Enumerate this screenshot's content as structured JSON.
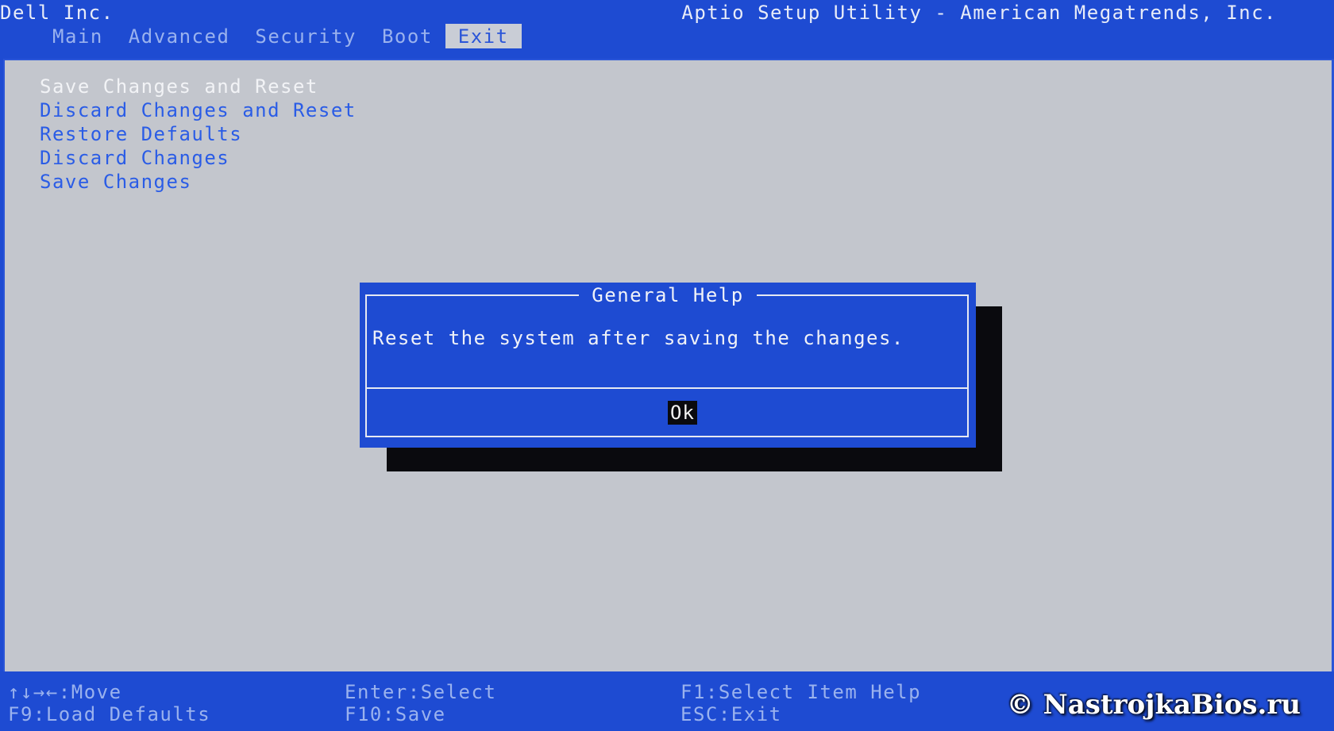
{
  "header": {
    "vendor": "Dell Inc.",
    "title": "Aptio Setup Utility - American Megatrends, Inc."
  },
  "tabs": [
    {
      "label": "Main",
      "active": false
    },
    {
      "label": "Advanced",
      "active": false
    },
    {
      "label": "Security",
      "active": false
    },
    {
      "label": "Boot",
      "active": false
    },
    {
      "label": "Exit",
      "active": true
    }
  ],
  "menu": {
    "items": [
      "Save Changes and Reset",
      "Discard Changes and Reset",
      "Restore Defaults",
      "Discard Changes",
      "Save Changes"
    ],
    "selected_index": 0
  },
  "dialog": {
    "title": "General Help",
    "message": "Reset the system after saving the changes.",
    "ok_label": "Ok"
  },
  "footer": {
    "move": "↑↓→←:Move",
    "select": "Enter:Select",
    "item_help": "F1:Select Item Help",
    "load_defaults": "F9:Load Defaults",
    "save": "F10:Save",
    "exit": "ESC:Exit"
  },
  "watermark": "© NastrojkaBios.ru",
  "colors": {
    "bios_blue": "#1e4bd2",
    "panel_grey": "#c3c6cd",
    "menu_text": "#2a5ce6",
    "selected_text": "#f2f3f6",
    "dim_text": "#9ab2ee"
  }
}
